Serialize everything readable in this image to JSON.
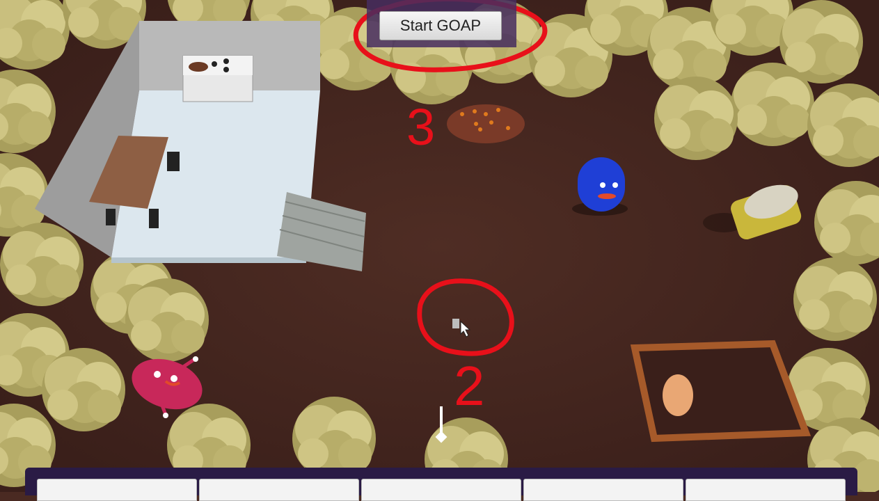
{
  "hud": {
    "start_button_label": "Start GOAP"
  },
  "annotations": [
    "3",
    "2"
  ],
  "toolbar": {
    "slots": [
      "",
      "",
      "",
      "",
      ""
    ]
  },
  "colors": {
    "ground": "#4a2a22",
    "tree": "#c9bf7e",
    "annotation": "#e8101a",
    "agent_blue": "#1f3fd6",
    "agent_pink": "#c8285a",
    "fence": "#a65a2a",
    "toolbar": "#2a1b45"
  },
  "icons": [
    "mouse-cursor-icon",
    "waypoint-marker-icon"
  ]
}
